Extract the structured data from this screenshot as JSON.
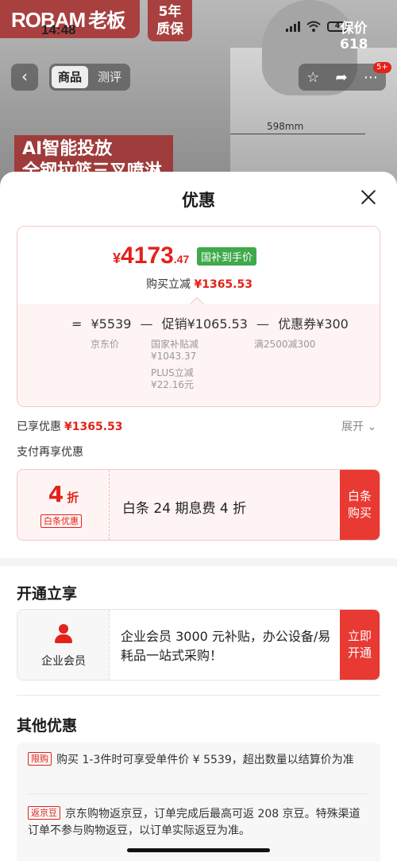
{
  "background": {
    "brand": "ROBAM",
    "brand_cn": "老板",
    "warranty_line1": "5年",
    "warranty_line2": "质保",
    "status_time": "14:48",
    "battery": "4",
    "promo_line1": "保价",
    "promo_line2": "618",
    "tabs": [
      "商品",
      "测评"
    ],
    "cart_badge": "5+",
    "dimension": "598mm",
    "banner_line1": "AI智能投放",
    "banner_line2": "全钢拉篮三叉喷淋"
  },
  "sheet": {
    "title": "优惠",
    "price": {
      "currency": "¥",
      "integer": "4173",
      "decimal": ".47",
      "tag": "国补到手价",
      "discount_label": "购买立减",
      "discount_value": "¥1365.53"
    },
    "formula": {
      "eq": "=",
      "base": "¥5539",
      "minus1": "—",
      "promo": "促销¥1065.53",
      "minus2": "—",
      "coupon": "优惠券¥300"
    },
    "notes": {
      "base_label": "京东价",
      "subsidy_label": "国家补贴减",
      "subsidy_value": "¥1043.37",
      "plus_label": "PLUS立减",
      "plus_value": "¥22.16元",
      "coupon_label": "满2500减300"
    },
    "enjoyed_label": "已享优惠",
    "enjoyed_value": "¥1365.53",
    "expand_label": "展开",
    "pay_more_label": "支付再享优惠",
    "baitiao": {
      "discount_num": "4",
      "discount_unit": "折",
      "tag": "白条优惠",
      "desc": "白条 24 期息费 4 折",
      "button": "白条购买"
    },
    "open_section_title": "开通立享",
    "enterprise": {
      "label": "企业会员",
      "desc": "企业会员 3000 元补贴，办公设备/易耗品一站式采购！",
      "button": "立即开通"
    },
    "other_section_title": "其他优惠",
    "other_items": [
      {
        "tag": "限购",
        "text": "购买 1-3件时可享受单件价 ¥ 5539，超出数量以结算价为准"
      },
      {
        "tag": "返京豆",
        "text": "京东购物返京豆，订单完成后最高可返 208 京豆。特殊渠道订单不参与购物返豆，以订单实际返豆为准。"
      }
    ]
  },
  "icons": [
    "back-arrow-icon",
    "star-icon",
    "share-icon",
    "more-icon",
    "close-icon",
    "chevron-down-icon",
    "person-icon"
  ],
  "colors": {
    "accent_red": "#e2231a",
    "subsidy_green": "#3fa94b",
    "button_red": "#e83a33"
  }
}
